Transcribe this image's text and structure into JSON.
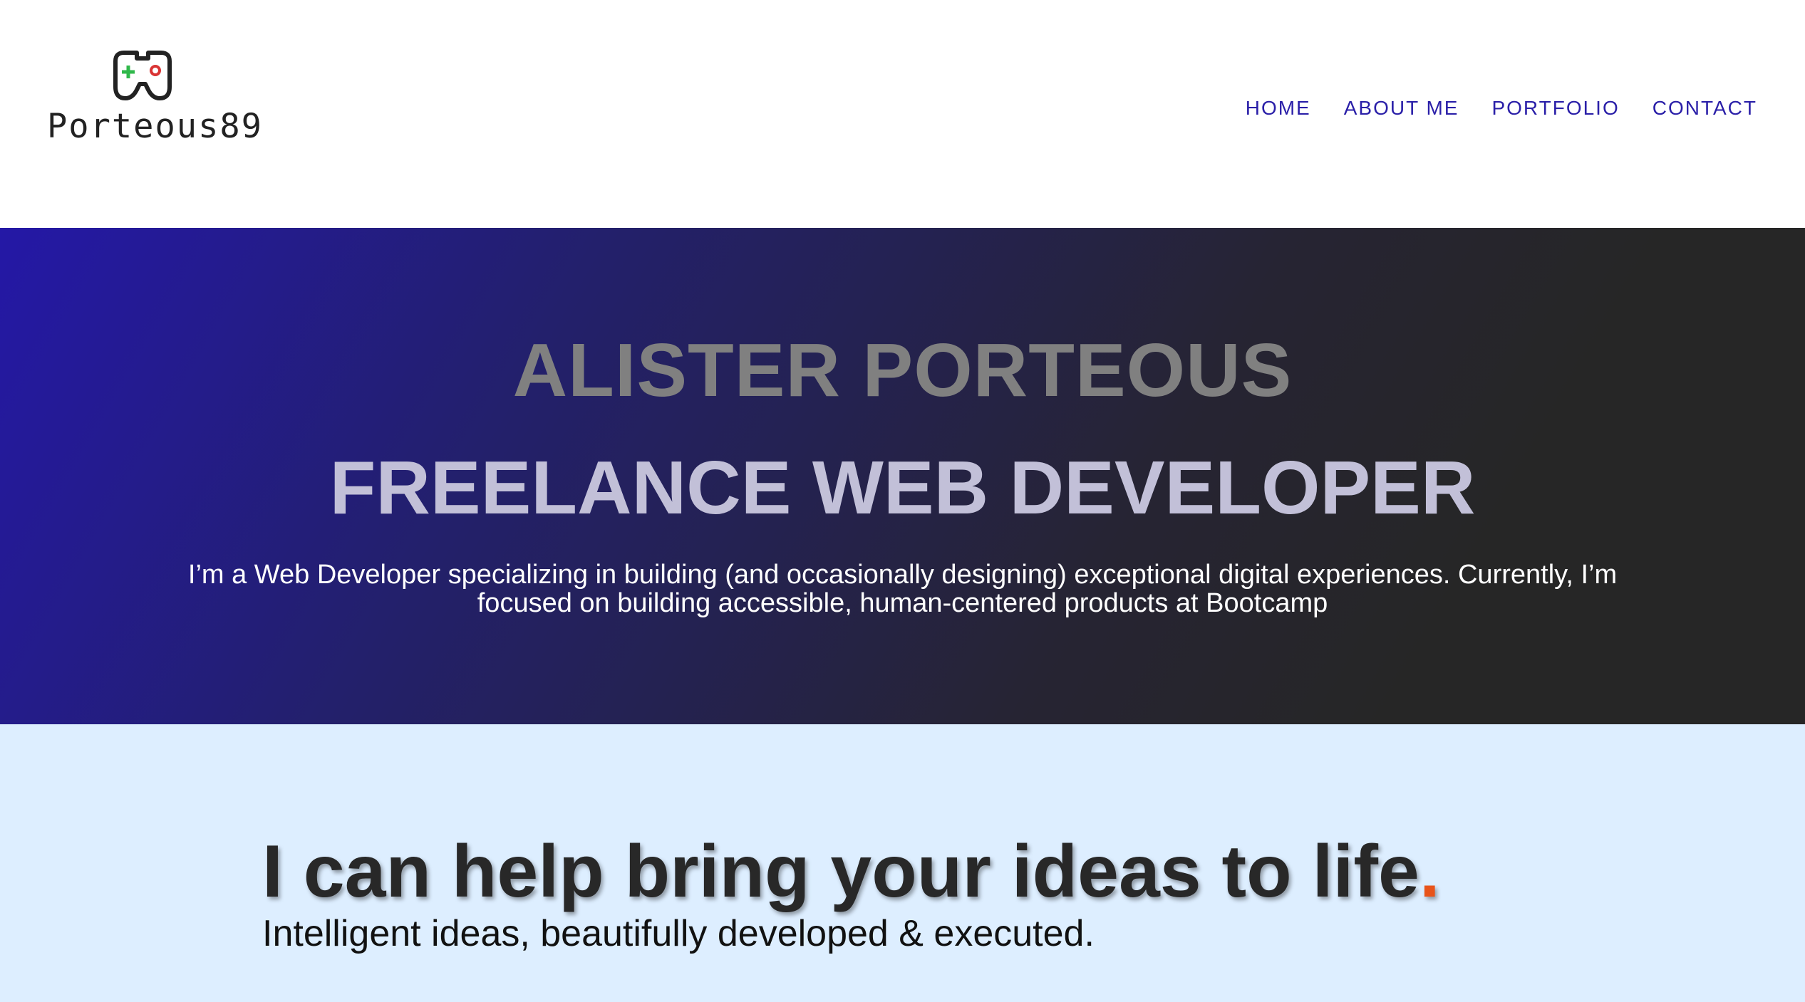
{
  "header": {
    "logo_text": "Porteous89",
    "logo_icon": "gamepad-icon",
    "nav": [
      {
        "label": "HOME"
      },
      {
        "label": "ABOUT ME"
      },
      {
        "label": "PORTFOLIO"
      },
      {
        "label": "CONTACT"
      }
    ]
  },
  "hero": {
    "name": "ALISTER PORTEOUS",
    "title": "FREELANCE WEB DEVELOPER",
    "description": "I’m a Web Developer specializing in building (and occasionally designing) exceptional digital experiences. Currently, I’m focused on building accessible, human-centered products at Bootcamp"
  },
  "tagline": {
    "part1": "I can help bring your ",
    "bold": "ideas",
    "part2": " to life",
    "dot": ".",
    "sub": "Intelligent ideas, beautifully developed & executed."
  },
  "colors": {
    "nav": "#2a1fa8",
    "accent_dot": "#e8541b",
    "hero_gradient_start": "#2418a6",
    "hero_gradient_end": "#262626",
    "tagline_bg": "#ddeeff"
  }
}
